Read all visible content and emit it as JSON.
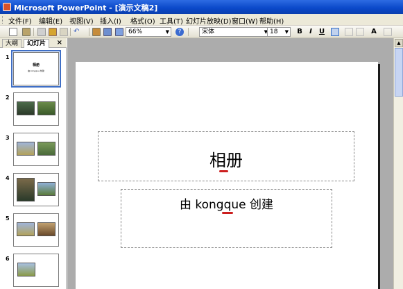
{
  "window": {
    "title": "Microsoft PowerPoint - [演示文稿2]"
  },
  "menu": {
    "items": [
      "文件(F)",
      "编辑(E)",
      "视图(V)",
      "插入(I)",
      "格式(O)",
      "工具(T)",
      "幻灯片放映(D)",
      "窗口(W)",
      "帮助(H)"
    ]
  },
  "toolbar": {
    "zoom_value": "66%",
    "font_value": "宋体",
    "font_size_value": "18",
    "bold_label": "B",
    "italic_label": "I",
    "underline_label": "U",
    "font_grow_label": "A"
  },
  "outline_pane": {
    "tab_outline": "大纲",
    "tab_slides": "幻灯片",
    "close_label": "×",
    "slides": [
      {
        "number": "1",
        "title": "相册",
        "subtitle": "由 kongque 创建"
      },
      {
        "number": "2"
      },
      {
        "number": "3"
      },
      {
        "number": "4"
      },
      {
        "number": "5"
      },
      {
        "number": "6"
      }
    ]
  },
  "slide": {
    "title": "相册",
    "subtitle": "由 kongque 创建"
  },
  "colors": {
    "titlebar": "#0a48c9",
    "annotation_mark": "#cc1f1f",
    "selection": "#3f6fc6"
  }
}
